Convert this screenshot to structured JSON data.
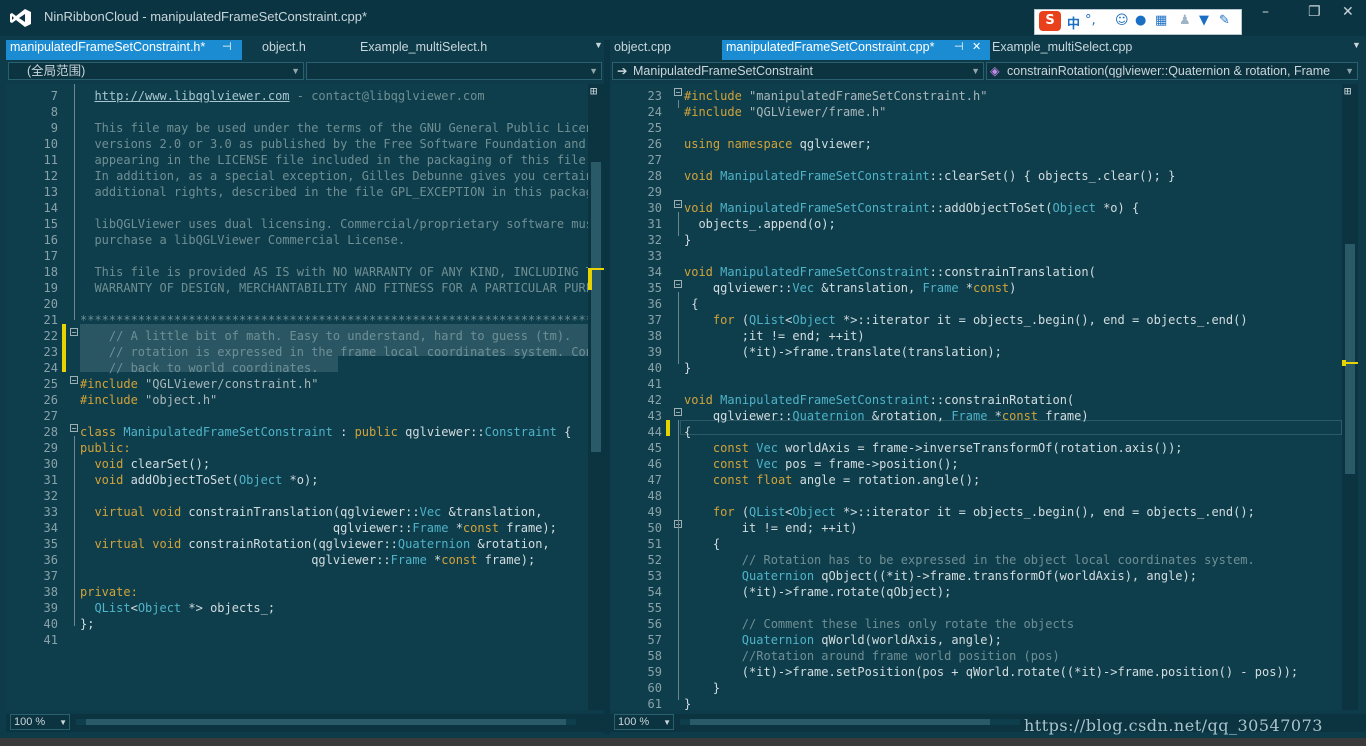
{
  "app_title": "NinRibbonCloud - manipulatedFrameSetConstraint.cpp*",
  "ime_toolbar": {
    "logo": "S",
    "lang": "中",
    "punct": "°,"
  },
  "window_buttons": {
    "minimize": "–",
    "restore": "❐",
    "close": "✕"
  },
  "left_pane": {
    "tabs": [
      {
        "label": "manipulatedFrameSetConstraint.h*",
        "active": true
      },
      {
        "label": "object.h"
      },
      {
        "label": "Example_multiSelect.h"
      }
    ],
    "scope_combo": "(全局范围)",
    "member_combo": "",
    "zoom": "100 %",
    "lines": [
      [
        "7",
        "  <a>http://www.libqglviewer.com</a><c> - contact@libqglviewer.com</c>"
      ],
      [
        "8",
        ""
      ],
      [
        "9",
        "<c>  This file may be used under the terms of the GNU General Public License</c>"
      ],
      [
        "10",
        "<c>  versions 2.0 or 3.0 as published by the Free Software Foundation and</c>"
      ],
      [
        "11",
        "<c>  appearing in the LICENSE file included in the packaging of this file.</c>"
      ],
      [
        "12",
        "<c>  In addition, as a special exception, Gilles Debunne gives you certain</c>"
      ],
      [
        "13",
        "<c>  additional rights, described in the file GPL_EXCEPTION in this package.</c>"
      ],
      [
        "14",
        ""
      ],
      [
        "15",
        "<c>  libQGLViewer uses dual licensing. Commercial/proprietary software must</c>"
      ],
      [
        "16",
        "<c>  purchase a libQGLViewer Commercial License.</c>"
      ],
      [
        "17",
        ""
      ],
      [
        "18",
        "<c>  This file is provided AS IS with NO WARRANTY OF ANY KIND, INCLUDING THE</c>"
      ],
      [
        "19",
        "<c>  WARRANTY OF DESIGN, MERCHANTABILITY AND FITNESS FOR A PARTICULAR PURPOSE.</c>"
      ],
      [
        "20",
        ""
      ],
      [
        "21",
        "<c>*****************************************************************************/</c>"
      ],
      [
        "22",
        "<c>    // A little bit of math. Easy to understand, hard to guess (tm).</c>"
      ],
      [
        "23",
        "<c>    // rotation is expressed in the frame local coordinates system. Convert it</c>"
      ],
      [
        "24",
        "<c>    // back to world coordinates.</c>"
      ],
      [
        "25",
        "<p>#include</p> <s>\"QGLViewer/constraint.h\"</s>"
      ],
      [
        "26",
        "<p>#include</p> <s>\"object.h\"</s>"
      ],
      [
        "27",
        ""
      ],
      [
        "28",
        "<k>class</k> <t>ManipulatedFrameSetConstraint</t> : <k>public</k> qglviewer::<t>Constraint</t> {"
      ],
      [
        "29",
        "<k>public:</k>"
      ],
      [
        "30",
        "  <k>void</k> clearSet();"
      ],
      [
        "31",
        "  <k>void</k> addObjectToSet(<t>Object</t> *o);"
      ],
      [
        "32",
        ""
      ],
      [
        "33",
        "  <k>virtual</k> <k>void</k> constrainTranslation(qglviewer::<t>Vec</t> &translation,"
      ],
      [
        "34",
        "                                   qglviewer::<t>Frame</t> *<k>const</k> frame);"
      ],
      [
        "35",
        "  <k>virtual</k> <k>void</k> constrainRotation(qglviewer::<t>Quaternion</t> &rotation,"
      ],
      [
        "36",
        "                                qglviewer::<t>Frame</t> *<k>const</k> frame);"
      ],
      [
        "37",
        ""
      ],
      [
        "38",
        "<k>private:</k>"
      ],
      [
        "39",
        "  <t>QList</t>&lt;<t>Object</t> *&gt; objects_;"
      ],
      [
        "40",
        "};"
      ],
      [
        "41",
        ""
      ]
    ]
  },
  "right_pane": {
    "tabs": [
      {
        "label": "object.cpp"
      },
      {
        "label": "manipulatedFrameSetConstraint.cpp*",
        "active": true
      },
      {
        "label": "Example_multiSelect.cpp"
      }
    ],
    "class_combo": "ManipulatedFrameSetConstraint",
    "member_combo": "constrainRotation(qglviewer::Quaternion & rotation, Frame",
    "zoom": "100 %",
    "lines": [
      [
        "23",
        "<p>#include</p> <s>\"manipulatedFrameSetConstraint.h\"</s>"
      ],
      [
        "24",
        "<p>#include</p> <s>\"QGLViewer/frame.h\"</s>"
      ],
      [
        "25",
        ""
      ],
      [
        "26",
        "<k>using</k> <k>namespace</k> qglviewer;"
      ],
      [
        "27",
        ""
      ],
      [
        "28",
        "<k>void</k> <t>ManipulatedFrameSetConstraint</t>::clearSet() { objects_.clear(); }"
      ],
      [
        "29",
        ""
      ],
      [
        "30",
        "<k>void</k> <t>ManipulatedFrameSetConstraint</t>::addObjectToSet(<t>Object</t> *o) {"
      ],
      [
        "31",
        "  objects_.append(o);"
      ],
      [
        "32",
        "}"
      ],
      [
        "33",
        ""
      ],
      [
        "34",
        "<k>void</k> <t>ManipulatedFrameSetConstraint</t>::constrainTranslation("
      ],
      [
        "35",
        "    qglviewer::<t>Vec</t> &translation, <t>Frame</t> *<k>const</k>)"
      ],
      [
        "36",
        " {"
      ],
      [
        "37",
        "    <k>for</k> (<t>QList</t>&lt;<t>Object</t> *&gt;::iterator it = objects_.begin(), end = objects_.end()"
      ],
      [
        "38",
        "        ;it != end; ++it)"
      ],
      [
        "39",
        "        (*it)->frame.translate(translation);"
      ],
      [
        "40",
        "}"
      ],
      [
        "41",
        ""
      ],
      [
        "42",
        "<k>void</k> <t>ManipulatedFrameSetConstraint</t>::constrainRotation("
      ],
      [
        "43",
        "    qglviewer::<t>Quaternion</t> &rotation, <t>Frame</t> *<k>const</k> frame)"
      ],
      [
        "44",
        "{"
      ],
      [
        "45",
        "    <k>const</k> <t>Vec</t> worldAxis = frame->inverseTransformOf(rotation.axis());"
      ],
      [
        "46",
        "    <k>const</k> <t>Vec</t> pos = frame->position();"
      ],
      [
        "47",
        "    <k>const</k> <k>float</k> angle = rotation.angle();"
      ],
      [
        "48",
        ""
      ],
      [
        "49",
        "    <k>for</k> (<t>QList</t>&lt;<t>Object</t> *&gt;::iterator it = objects_.begin(), end = objects_.end();"
      ],
      [
        "50",
        "        it != end; ++it)"
      ],
      [
        "51",
        "    {"
      ],
      [
        "52",
        "<c>        // Rotation has to be expressed in the object local coordinates system.</c>"
      ],
      [
        "53",
        "        <t>Quaternion</t> qObject((*it)->frame.transformOf(worldAxis), angle);"
      ],
      [
        "54",
        "        (*it)->frame.rotate(qObject);"
      ],
      [
        "55",
        ""
      ],
      [
        "56",
        "<c>        // Comment these lines only rotate the objects</c>"
      ],
      [
        "57",
        "        <t>Quaternion</t> qWorld(worldAxis, angle);"
      ],
      [
        "58",
        "<c>        //Rotation around frame world position (pos)</c>"
      ],
      [
        "59",
        "        (*it)->frame.setPosition(pos + qWorld.rotate((*it)->frame.position() - pos));"
      ],
      [
        "60",
        "    }"
      ],
      [
        "61",
        "}"
      ]
    ]
  },
  "watermark": "https://blog.csdn.net/qq_30547073"
}
